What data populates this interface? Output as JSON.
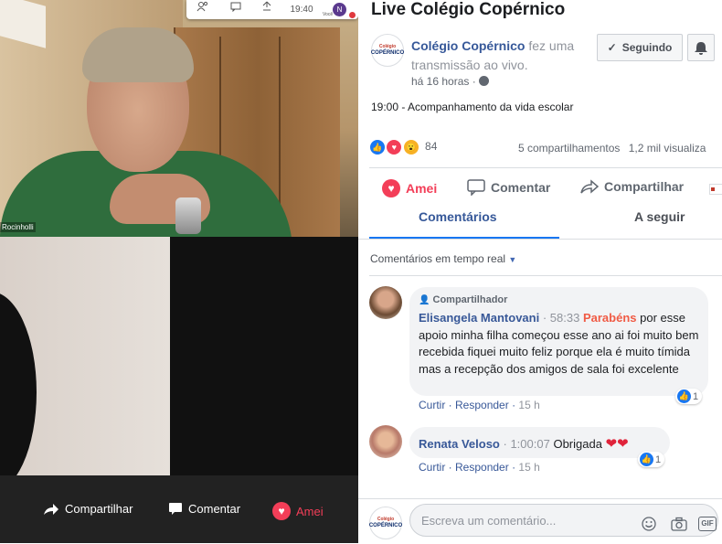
{
  "zoom": {
    "time": "19:40",
    "avatar_initial": "N",
    "you_label": "Você",
    "participant_name": "Rocinholli"
  },
  "video_controls": {
    "share": "Compartilhar",
    "comment": "Comentar",
    "love": "Amei"
  },
  "post": {
    "title": "Live Colégio Copérnico",
    "page_name": "Colégio Copérnico",
    "action_text": "fez uma transmissão ao vivo.",
    "time_ago": "há 16 horas",
    "privacy_icon": "globe-icon",
    "follow_button": "Seguindo",
    "logo_text_top": "Colégio",
    "logo_text_bottom": "COPÉRNICO",
    "description": "19:00 - Acompanhamento da vida escolar",
    "reaction_count": "84",
    "shares": "5 compartilhamentos",
    "views": "1,2 mil visualiza"
  },
  "actions": {
    "love": "Amei",
    "comment": "Comentar",
    "share": "Compartilhar"
  },
  "tabs": {
    "comments": "Comentários",
    "following": "A seguir"
  },
  "comments_filter": "Comentários em tempo real",
  "comments": [
    {
      "badge": "Compartilhador",
      "name": "Elisangela Mantovani",
      "timestamp": "58:33",
      "highlight": "Parabéns",
      "text_first": "por",
      "text_rest": "esse apoio minha filha começou esse ano ai foi muito bem recebida fiquei muito feliz porque ela é muito tímida mas a recepção dos amigos de sala foi excelente",
      "like": "Curtir",
      "reply": "Responder",
      "time": "15 h",
      "like_count": "1"
    },
    {
      "name": "Renata Veloso",
      "timestamp": "1:00:07",
      "text": "Obrigada",
      "hearts": "❤❤",
      "like": "Curtir",
      "reply": "Responder",
      "time": "15 h",
      "like_count": "1"
    }
  ],
  "composer": {
    "placeholder": "Escreva um comentário...",
    "gif_label": "GIF"
  },
  "colors": {
    "accent_red": "#f33e58",
    "link_blue": "#385898",
    "tab_blue": "#1877f2",
    "zoom_green": "#2f6d3d"
  }
}
